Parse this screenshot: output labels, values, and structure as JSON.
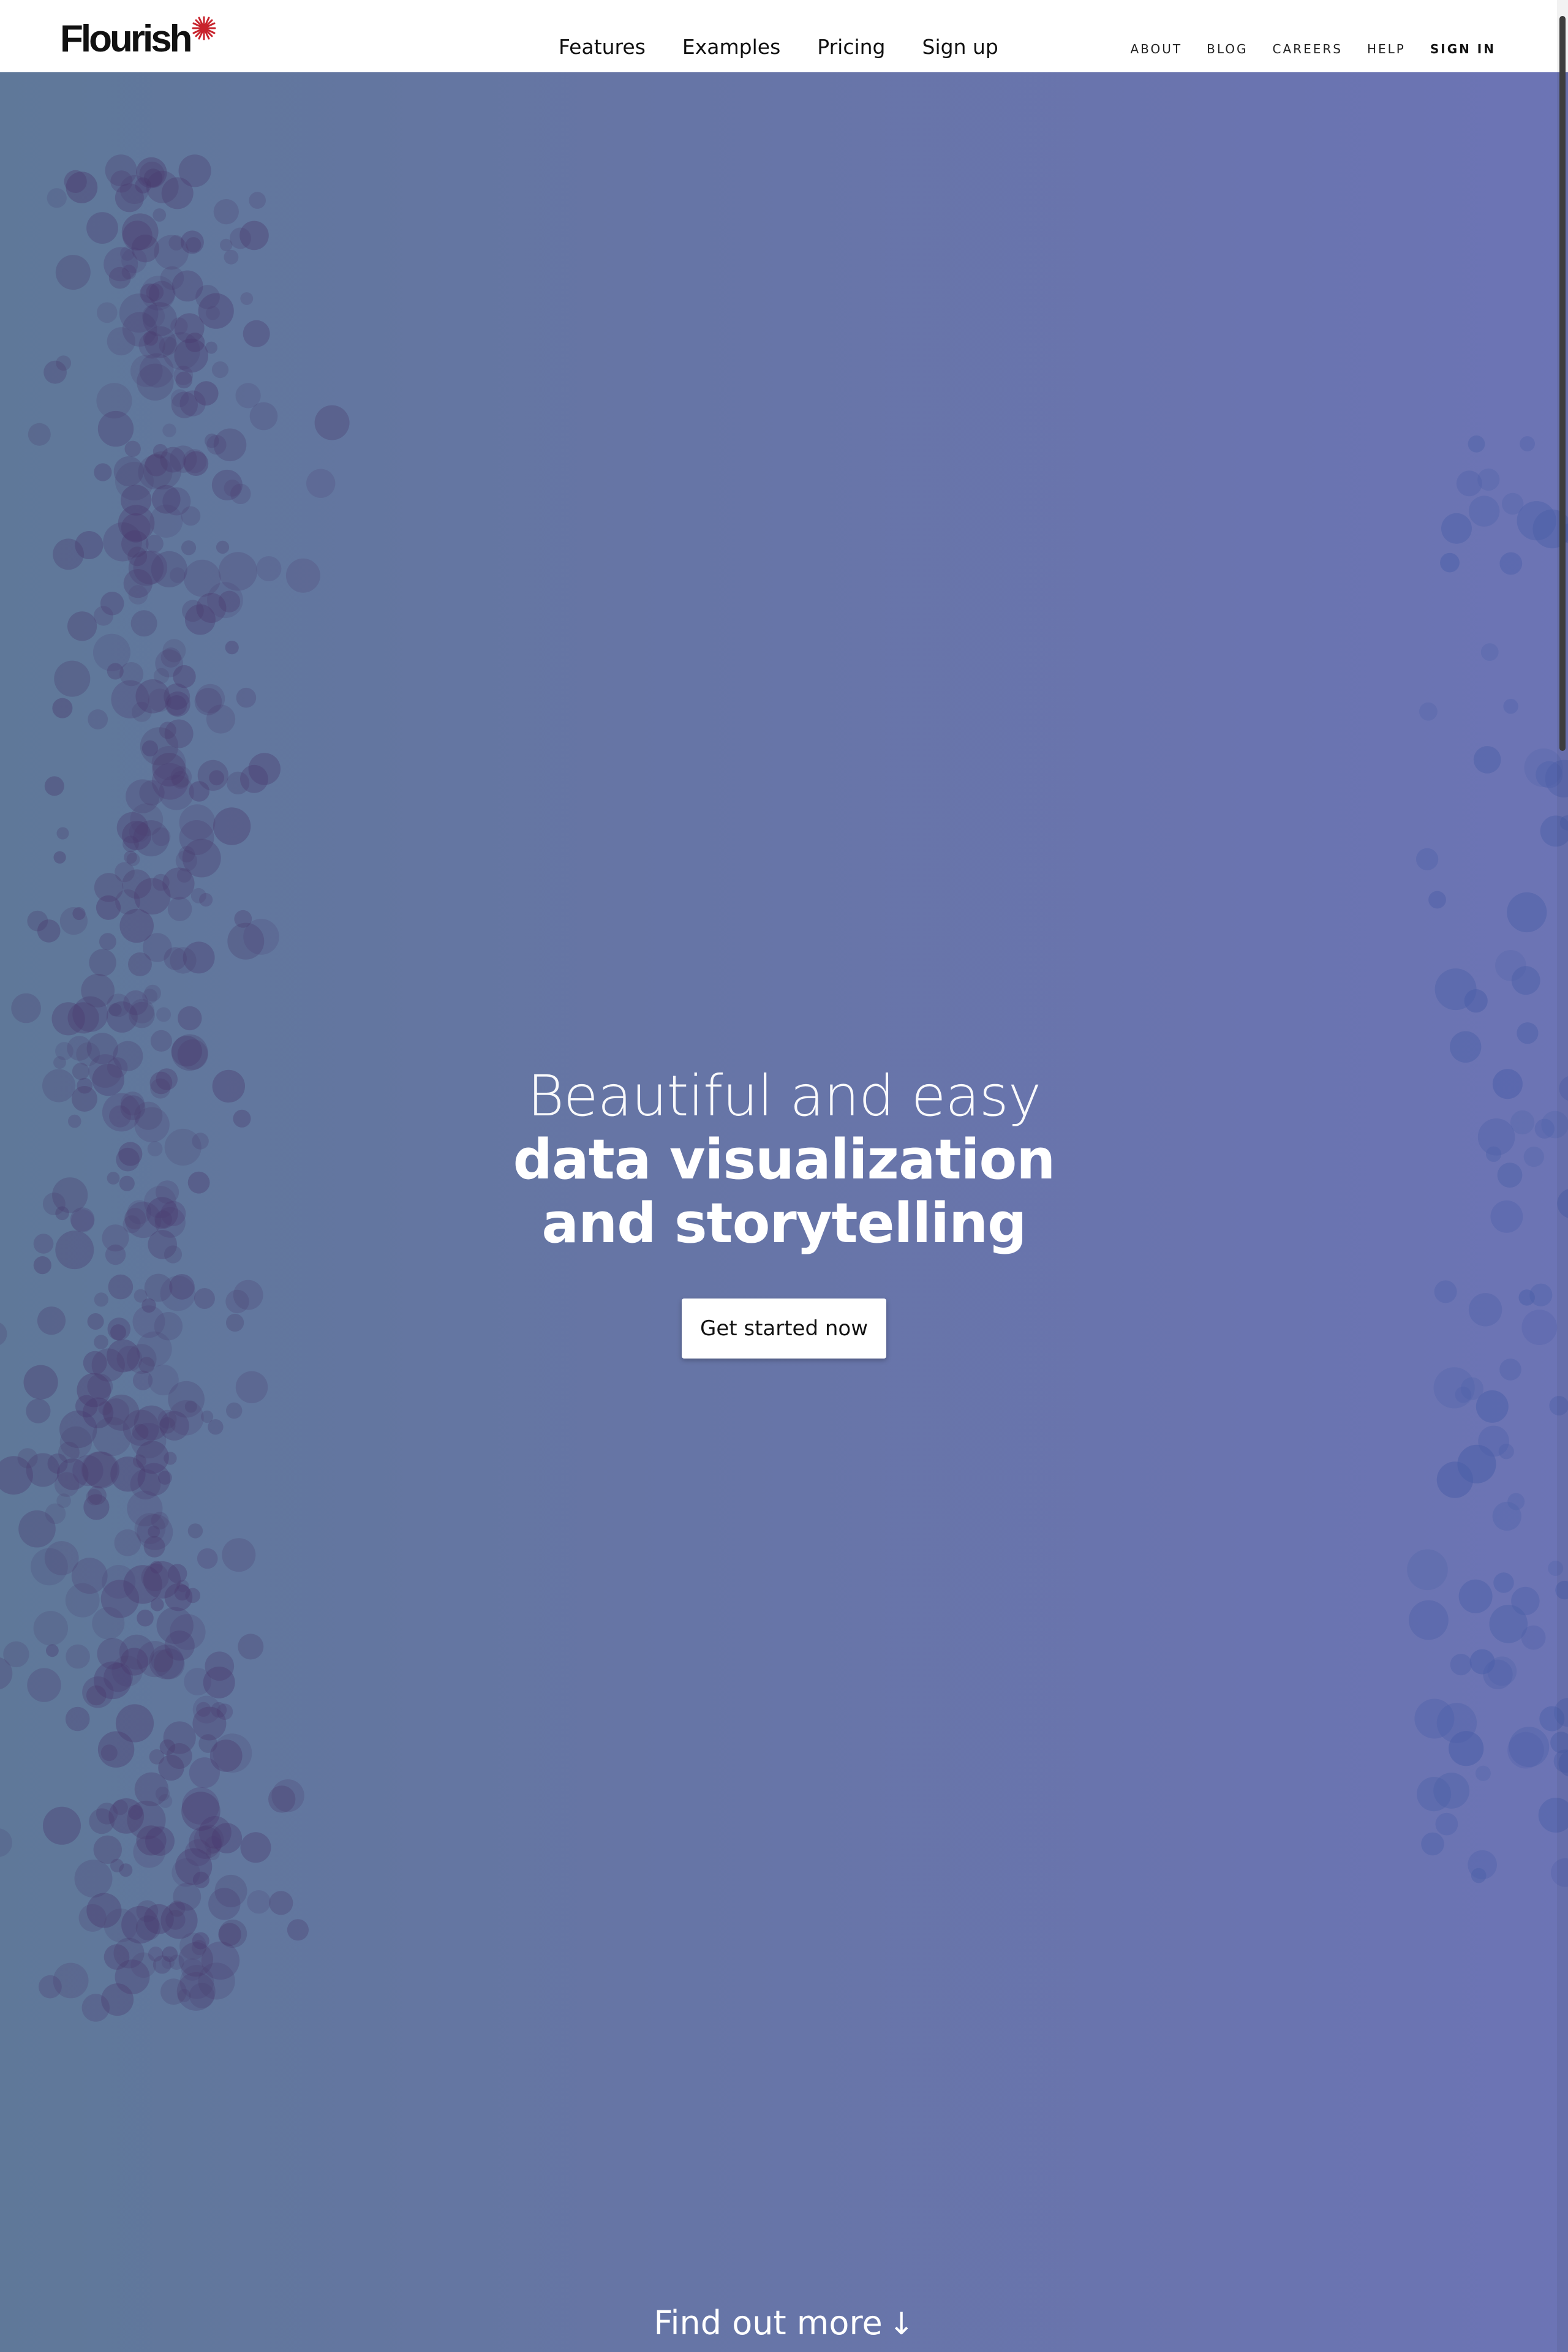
{
  "brand": {
    "name": "Flourish",
    "accent_color": "#c8232c"
  },
  "main_nav": [
    {
      "label": "Features"
    },
    {
      "label": "Examples"
    },
    {
      "label": "Pricing"
    },
    {
      "label": "Sign up"
    }
  ],
  "util_nav": [
    {
      "label": "ABOUT"
    },
    {
      "label": "BLOG"
    },
    {
      "label": "CAREERS"
    },
    {
      "label": "HELP"
    },
    {
      "label": "SIGN IN"
    }
  ],
  "hero": {
    "line1": "Beautiful and easy",
    "line2": "data visualization",
    "line3": "and storytelling",
    "cta_label": "Get started now",
    "find_more_label": "Find out more",
    "find_more_icon": "arrow-down-icon",
    "gradient_start": "#5f7899",
    "gradient_end": "#6c74b5",
    "bubble_color": "#4a3a6e"
  }
}
